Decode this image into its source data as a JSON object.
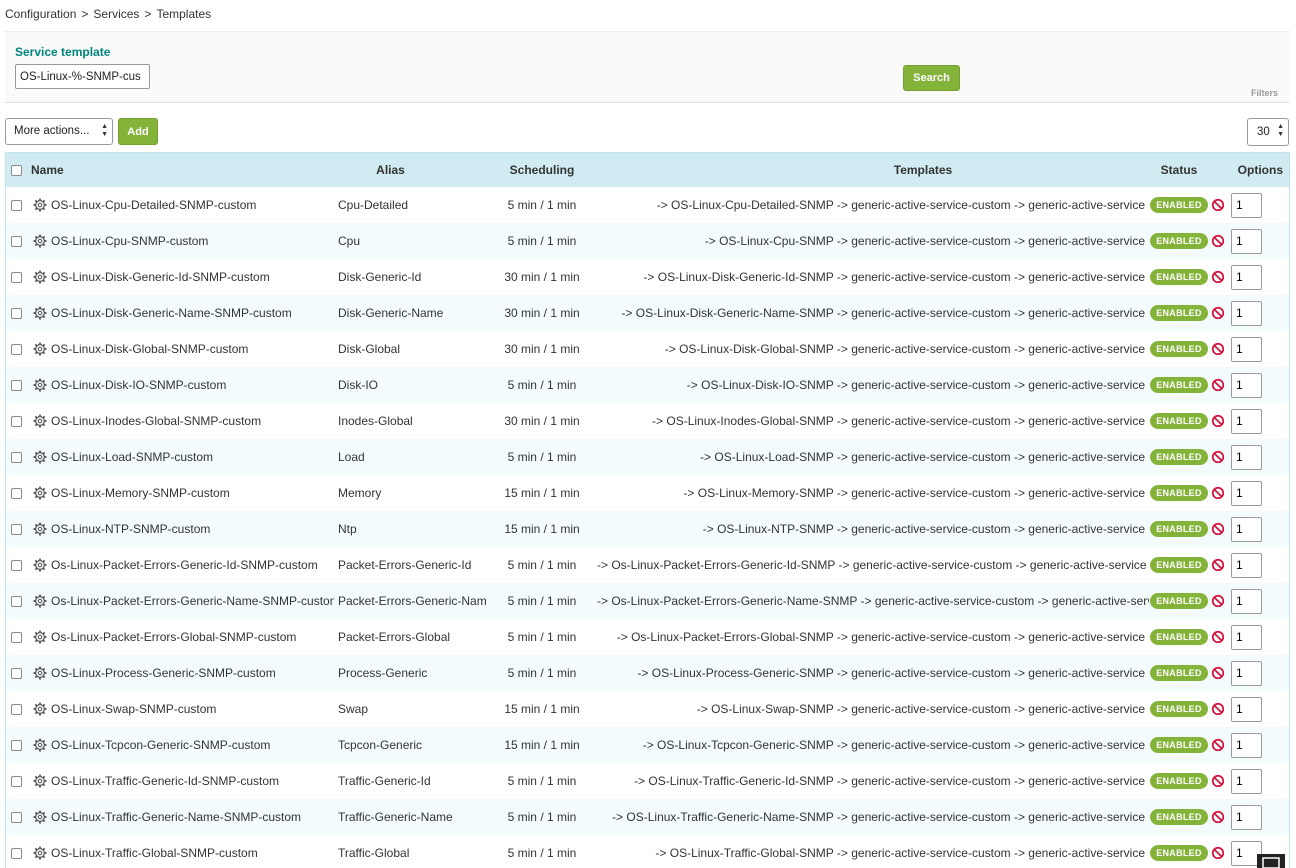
{
  "breadcrumb": [
    "Configuration",
    "Services",
    "Templates"
  ],
  "breadcrumb_separator": ">",
  "filter": {
    "label": "Service template",
    "value": "OS-Linux-%-SNMP-cus",
    "search_label": "Search",
    "filters_label": "Filters"
  },
  "toolbar": {
    "more_actions": "More actions...",
    "add_label": "Add",
    "page_size": "30"
  },
  "colors": {
    "accent_green": "#84b33a",
    "header_bg": "#d1ebf3",
    "label_teal": "#00857c",
    "disable_red": "#d4123b"
  },
  "table": {
    "columns": [
      "Name",
      "Alias",
      "Scheduling",
      "Templates",
      "Status",
      "Options"
    ],
    "rows": [
      {
        "name": "OS-Linux-Cpu-Detailed-SNMP-custom",
        "alias": "Cpu-Detailed",
        "scheduling": "5 min / 1 min",
        "templates": "-> OS-Linux-Cpu-Detailed-SNMP -> generic-active-service-custom -> generic-active-service",
        "status": "ENABLED",
        "dup": "1"
      },
      {
        "name": "OS-Linux-Cpu-SNMP-custom",
        "alias": "Cpu",
        "scheduling": "5 min / 1 min",
        "templates": "-> OS-Linux-Cpu-SNMP -> generic-active-service-custom -> generic-active-service",
        "status": "ENABLED",
        "dup": "1"
      },
      {
        "name": "OS-Linux-Disk-Generic-Id-SNMP-custom",
        "alias": "Disk-Generic-Id",
        "scheduling": "30 min / 1 min",
        "templates": "-> OS-Linux-Disk-Generic-Id-SNMP -> generic-active-service-custom -> generic-active-service",
        "status": "ENABLED",
        "dup": "1"
      },
      {
        "name": "OS-Linux-Disk-Generic-Name-SNMP-custom",
        "alias": "Disk-Generic-Name",
        "scheduling": "30 min / 1 min",
        "templates": "-> OS-Linux-Disk-Generic-Name-SNMP -> generic-active-service-custom -> generic-active-service",
        "status": "ENABLED",
        "dup": "1"
      },
      {
        "name": "OS-Linux-Disk-Global-SNMP-custom",
        "alias": "Disk-Global",
        "scheduling": "30 min / 1 min",
        "templates": "-> OS-Linux-Disk-Global-SNMP -> generic-active-service-custom -> generic-active-service",
        "status": "ENABLED",
        "dup": "1"
      },
      {
        "name": "OS-Linux-Disk-IO-SNMP-custom",
        "alias": "Disk-IO",
        "scheduling": "5 min / 1 min",
        "templates": "-> OS-Linux-Disk-IO-SNMP -> generic-active-service-custom -> generic-active-service",
        "status": "ENABLED",
        "dup": "1"
      },
      {
        "name": "OS-Linux-Inodes-Global-SNMP-custom",
        "alias": "Inodes-Global",
        "scheduling": "30 min / 1 min",
        "templates": "-> OS-Linux-Inodes-Global-SNMP -> generic-active-service-custom -> generic-active-service",
        "status": "ENABLED",
        "dup": "1"
      },
      {
        "name": "OS-Linux-Load-SNMP-custom",
        "alias": "Load",
        "scheduling": "5 min / 1 min",
        "templates": "-> OS-Linux-Load-SNMP -> generic-active-service-custom -> generic-active-service",
        "status": "ENABLED",
        "dup": "1"
      },
      {
        "name": "OS-Linux-Memory-SNMP-custom",
        "alias": "Memory",
        "scheduling": "15 min / 1 min",
        "templates": "-> OS-Linux-Memory-SNMP -> generic-active-service-custom -> generic-active-service",
        "status": "ENABLED",
        "dup": "1"
      },
      {
        "name": "OS-Linux-NTP-SNMP-custom",
        "alias": "Ntp",
        "scheduling": "15 min / 1 min",
        "templates": "-> OS-Linux-NTP-SNMP -> generic-active-service-custom -> generic-active-service",
        "status": "ENABLED",
        "dup": "1"
      },
      {
        "name": "Os-Linux-Packet-Errors-Generic-Id-SNMP-custom",
        "alias": "Packet-Errors-Generic-Id",
        "scheduling": "5 min / 1 min",
        "templates": "-> Os-Linux-Packet-Errors-Generic-Id-SNMP -> generic-active-service-custom -> generic-active-service",
        "status": "ENABLED",
        "dup": "1"
      },
      {
        "name": "Os-Linux-Packet-Errors-Generic-Name-SNMP-custom",
        "alias": "Packet-Errors-Generic-Name",
        "scheduling": "5 min / 1 min",
        "templates": "-> Os-Linux-Packet-Errors-Generic-Name-SNMP -> generic-active-service-custom -> generic-active-service",
        "status": "ENABLED",
        "dup": "1"
      },
      {
        "name": "Os-Linux-Packet-Errors-Global-SNMP-custom",
        "alias": "Packet-Errors-Global",
        "scheduling": "5 min / 1 min",
        "templates": "-> Os-Linux-Packet-Errors-Global-SNMP -> generic-active-service-custom -> generic-active-service",
        "status": "ENABLED",
        "dup": "1"
      },
      {
        "name": "OS-Linux-Process-Generic-SNMP-custom",
        "alias": "Process-Generic",
        "scheduling": "5 min / 1 min",
        "templates": "-> OS-Linux-Process-Generic-SNMP -> generic-active-service-custom -> generic-active-service",
        "status": "ENABLED",
        "dup": "1"
      },
      {
        "name": "OS-Linux-Swap-SNMP-custom",
        "alias": "Swap",
        "scheduling": "15 min / 1 min",
        "templates": "-> OS-Linux-Swap-SNMP -> generic-active-service-custom -> generic-active-service",
        "status": "ENABLED",
        "dup": "1"
      },
      {
        "name": "OS-Linux-Tcpcon-Generic-SNMP-custom",
        "alias": "Tcpcon-Generic",
        "scheduling": "15 min / 1 min",
        "templates": "-> OS-Linux-Tcpcon-Generic-SNMP -> generic-active-service-custom -> generic-active-service",
        "status": "ENABLED",
        "dup": "1"
      },
      {
        "name": "OS-Linux-Traffic-Generic-Id-SNMP-custom",
        "alias": "Traffic-Generic-Id",
        "scheduling": "5 min / 1 min",
        "templates": "-> OS-Linux-Traffic-Generic-Id-SNMP -> generic-active-service-custom -> generic-active-service",
        "status": "ENABLED",
        "dup": "1"
      },
      {
        "name": "OS-Linux-Traffic-Generic-Name-SNMP-custom",
        "alias": "Traffic-Generic-Name",
        "scheduling": "5 min / 1 min",
        "templates": "-> OS-Linux-Traffic-Generic-Name-SNMP -> generic-active-service-custom -> generic-active-service",
        "status": "ENABLED",
        "dup": "1"
      },
      {
        "name": "OS-Linux-Traffic-Global-SNMP-custom",
        "alias": "Traffic-Global",
        "scheduling": "5 min / 1 min",
        "templates": "-> OS-Linux-Traffic-Global-SNMP -> generic-active-service-custom -> generic-active-service",
        "status": "ENABLED",
        "dup": "1"
      }
    ]
  }
}
